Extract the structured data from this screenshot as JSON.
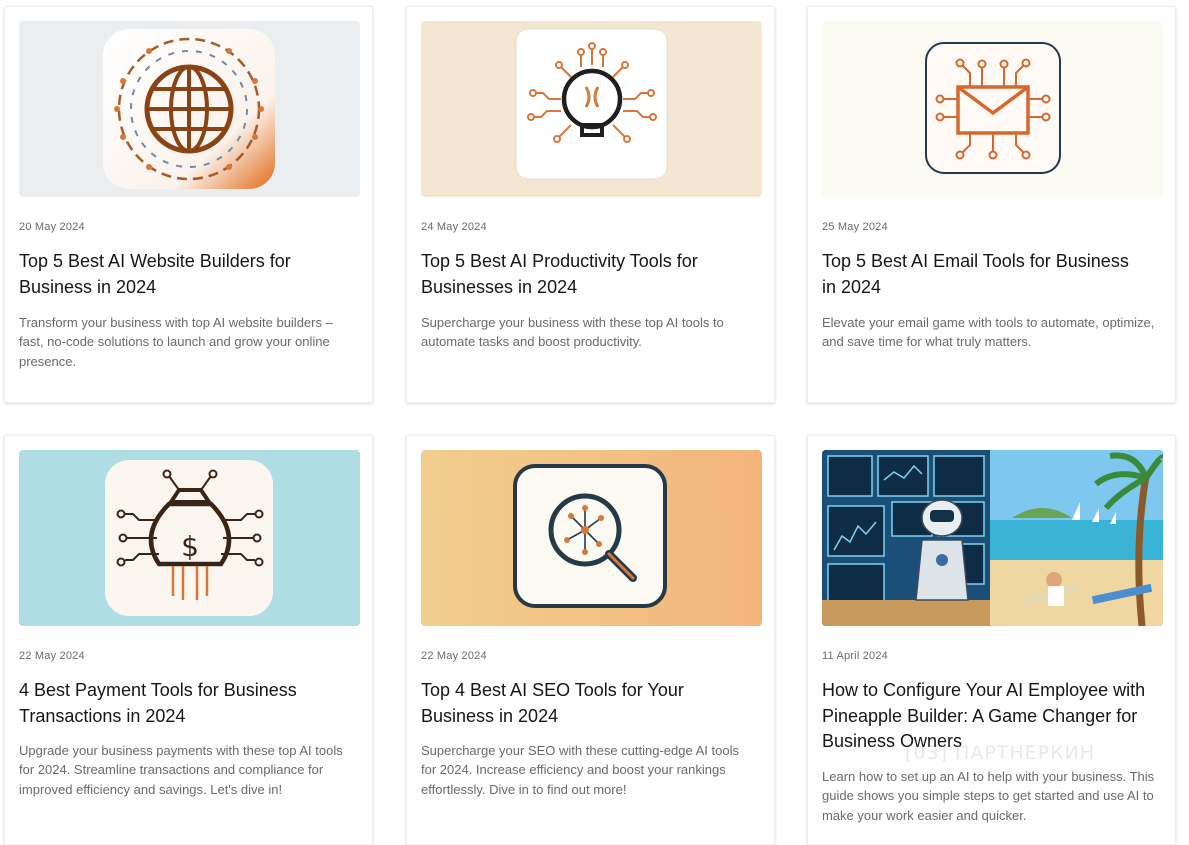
{
  "posts": [
    {
      "date": "20 May 2024",
      "title": "Top 5 Best AI Website Builders for Business in 2024",
      "excerpt": "Transform your business with top AI website builders – fast, no-code solutions to launch and grow your online presence.",
      "image_icon": "globe-circuit-icon"
    },
    {
      "date": "24 May 2024",
      "title": "Top 5 Best AI Productivity Tools for Businesses in 2024",
      "excerpt": "Supercharge your business with these top AI tools to automate tasks and boost productivity.",
      "image_icon": "lightbulb-circuit-icon"
    },
    {
      "date": "25 May 2024",
      "title": "Top 5 Best AI Email Tools for Business in 2024",
      "excerpt": "Elevate your email game with tools to automate, optimize, and save time for what truly matters.",
      "image_icon": "envelope-circuit-icon"
    },
    {
      "date": "22 May 2024",
      "title": "4 Best Payment Tools for Business Transactions in 2024",
      "excerpt": "Upgrade your business payments with these top AI tools for 2024. Streamline transactions and compliance for improved efficiency and savings. Let's dive in!",
      "image_icon": "money-bag-circuit-icon"
    },
    {
      "date": "22 May 2024",
      "title": "Top 4 Best AI SEO Tools for Your Business in 2024",
      "excerpt": "Supercharge your SEO with these cutting-edge AI tools for 2024. Increase efficiency and boost your rankings effortlessly. Dive in to find out more!",
      "image_icon": "magnifier-circuit-icon"
    },
    {
      "date": "11 April 2024",
      "title": "How to Configure Your AI Employee with Pineapple Builder: A Game Changer for Business Owners",
      "excerpt": "Learn how to set up an AI to help with your business. This guide shows you simple steps to get started and use AI to make your work easier and quicker.",
      "image_icon": "robot-beach-illustration"
    }
  ],
  "watermark": "[03] ПАРТНЕРКИН",
  "colors": {
    "accent_orange": "#d9773a",
    "title_text": "#161616",
    "muted_text": "#6a6a6a"
  }
}
